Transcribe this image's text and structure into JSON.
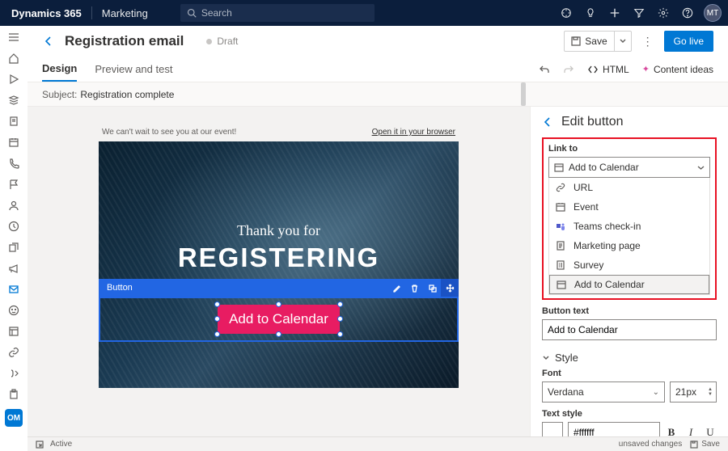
{
  "topbar": {
    "brand": "Dynamics 365",
    "module": "Marketing",
    "search_placeholder": "Search",
    "avatar": "MT"
  },
  "rail": {
    "badge": "OM"
  },
  "header": {
    "title": "Registration email",
    "status": "Draft",
    "save": "Save",
    "golive": "Go live"
  },
  "tabs": {
    "design": "Design",
    "preview": "Preview and test",
    "html": "HTML",
    "ideas": "Content ideas"
  },
  "subject": {
    "label": "Subject:",
    "value": "Registration complete"
  },
  "canvas": {
    "preheader_left": "We can't wait to see you at our event!",
    "preheader_right": "Open it in your browser",
    "thank": "Thank you for",
    "reg": "REGISTERING",
    "sel_label": "Button",
    "cta": "Add to Calendar"
  },
  "panel": {
    "title": "Edit button",
    "linkto_label": "Link to",
    "linkto_value": "Add to Calendar",
    "options": {
      "url": "URL",
      "event": "Event",
      "teams": "Teams check-in",
      "mpage": "Marketing page",
      "survey": "Survey",
      "atc": "Add to Calendar"
    },
    "btntext_label": "Button text",
    "btntext_value": "Add to Calendar",
    "style_label": "Style",
    "font_label": "Font",
    "font_value": "Verdana",
    "fontsize": "21px",
    "textstyle_label": "Text style",
    "hex": "#ffffff"
  },
  "status": {
    "active": "Active",
    "unsaved": "unsaved changes",
    "save": "Save"
  }
}
